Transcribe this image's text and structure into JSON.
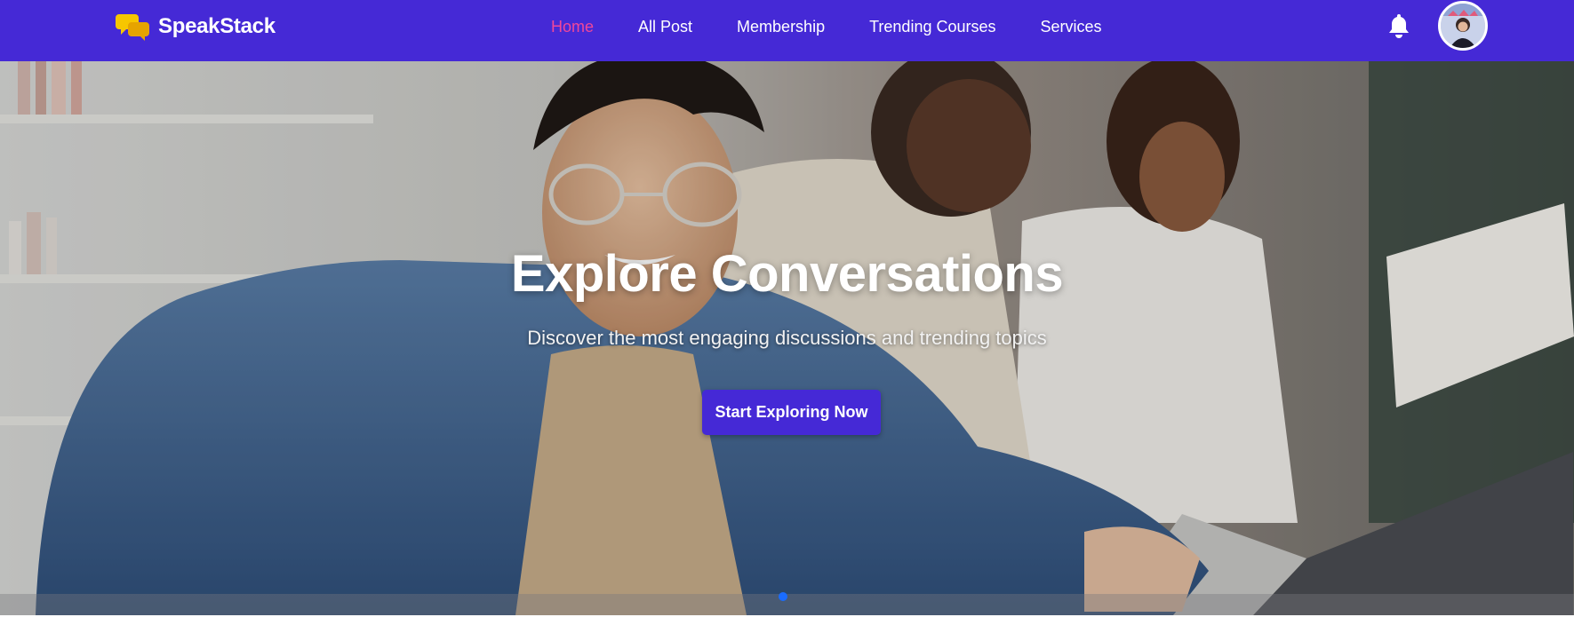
{
  "brand": {
    "name": "SpeakStack",
    "logo_icon": "chat-bubbles-icon",
    "logo_color": "#f7c600"
  },
  "nav": {
    "items": [
      {
        "label": "Home",
        "active": true
      },
      {
        "label": "All Post",
        "active": false
      },
      {
        "label": "Membership",
        "active": false
      },
      {
        "label": "Trending Courses",
        "active": false
      },
      {
        "label": "Services",
        "active": false
      }
    ],
    "notification_icon": "bell-icon",
    "avatar_icon": "user-avatar"
  },
  "hero": {
    "title": "Explore Conversations",
    "subtitle": "Discover the most engaging discussions and trending topics",
    "cta_label": "Start Exploring Now",
    "image": "students-studying-photo"
  },
  "carousel": {
    "active_index": 0
  },
  "colors": {
    "nav_bg": "#4529d6",
    "active_link": "#f0479a",
    "button_bg": "#4529d6",
    "dot": "#1a6cff"
  }
}
